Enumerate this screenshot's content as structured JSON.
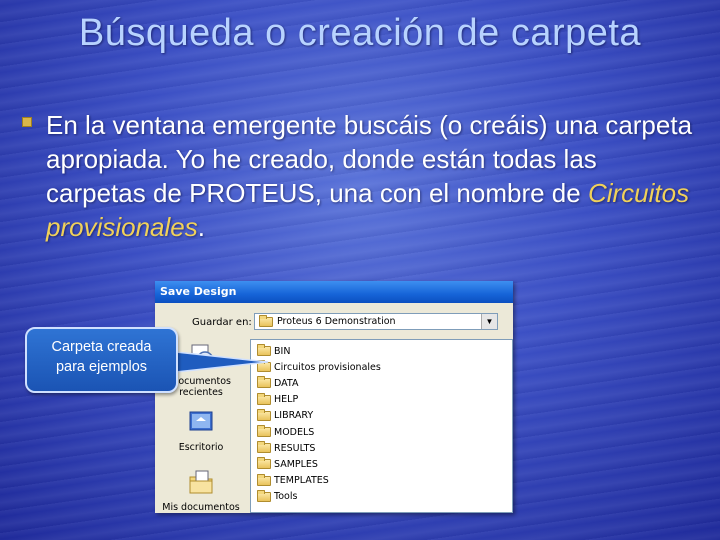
{
  "slide": {
    "title": "Búsqueda o creación de carpeta",
    "bullet": {
      "text_before": "En la ventana emergente buscáis (o creáis) una carpeta apropiada. Yo he creado, donde están todas las carpetas de PROTEUS, una con el nombre de ",
      "emphasis": "Circuitos provisionales",
      "text_after": "."
    }
  },
  "dialog": {
    "title": "Save Design",
    "save_in_label": "Guardar en:",
    "save_in_value": "Proteus 6 Demonstration",
    "places": [
      {
        "label_line1": "Documentos",
        "label_line2": "recientes",
        "icon": "recent-documents-icon"
      },
      {
        "label_line1": "Escritorio",
        "label_line2": "",
        "icon": "desktop-icon"
      },
      {
        "label_line1": "Mis documentos",
        "label_line2": "",
        "icon": "my-documents-icon"
      }
    ],
    "folders": [
      "BIN",
      "Circuitos provisionales",
      "DATA",
      "HELP",
      "LIBRARY",
      "MODELS",
      "RESULTS",
      "SAMPLES",
      "TEMPLATES",
      "Tools"
    ]
  },
  "callout": {
    "line1": "Carpeta creada",
    "line2": "para ejemplos"
  },
  "colors": {
    "title": "#b8d3ff",
    "emphasis": "#f0d15a",
    "bullet": "#d9b64a",
    "titlebar": "#1664d8"
  }
}
